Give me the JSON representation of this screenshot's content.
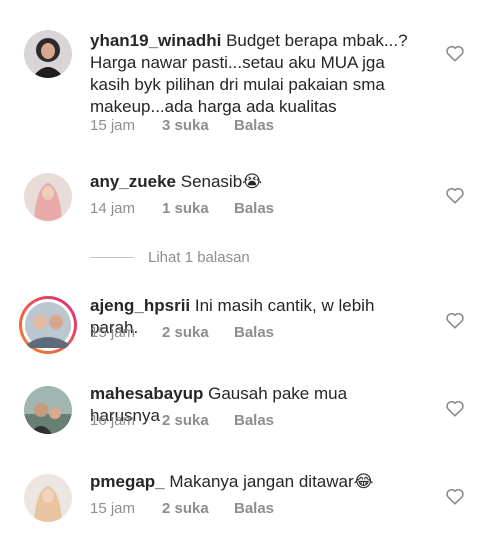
{
  "comments": [
    {
      "username": "yhan19_winadhi",
      "text": "Budget berapa mbak...? Harga nawar pasti...setau aku MUA jga kasih byk pilihan dri mulai pakaian sma makeup...ada harga ada kualitas",
      "time": "15 jam",
      "likes": "3 suka",
      "reply": "Balas"
    },
    {
      "username": "any_zueke",
      "text": "Senasib😭",
      "time": "14 jam",
      "likes": "1 suka",
      "reply": "Balas"
    },
    {
      "username": "ajeng_hpsrii",
      "text": "Ini masih cantik,  w lebih parah.",
      "time": "15 jam",
      "likes": "2 suka",
      "reply": "Balas"
    },
    {
      "username": "mahesabayup",
      "text": "Gausah pake mua harusnya",
      "time": "16 jam",
      "likes": "2 suka",
      "reply": "Balas"
    },
    {
      "username": "pmegap_",
      "text": "Makanya jangan ditawar😂",
      "time": "15 jam",
      "likes": "2 suka",
      "reply": "Balas"
    }
  ],
  "view_replies": "Lihat 1 balasan",
  "icons": {
    "like": "heart-outline-icon"
  },
  "colors": {
    "text": "#262626",
    "meta": "#8e8e8e",
    "story_ring_start": "#f58529",
    "story_ring_end": "#dd2a7b"
  }
}
